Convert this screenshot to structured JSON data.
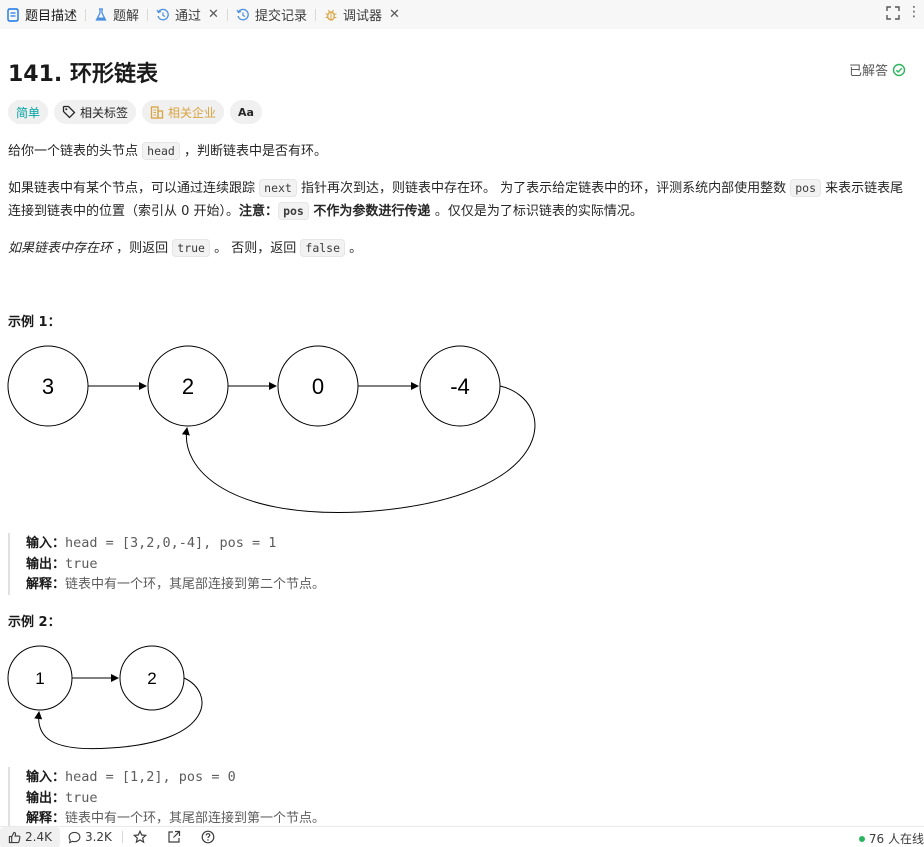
{
  "tabs": [
    {
      "label": "题目描述",
      "icon": "description-icon"
    },
    {
      "label": "题解",
      "icon": "flask-icon"
    },
    {
      "label": "通过",
      "icon": "history-icon"
    },
    {
      "label": "提交记录",
      "icon": "history-icon"
    },
    {
      "label": "调试器",
      "icon": "bug-icon"
    }
  ],
  "problem": {
    "title": "141. 环形链表",
    "solved_label": "已解答"
  },
  "tags": {
    "difficulty": "简单",
    "topics": "相关标签",
    "companies": "相关企业",
    "font_size": "Aa"
  },
  "description": {
    "p1_a": "给你一个链表的头节点 ",
    "p1_code": "head",
    "p1_b": " ，判断链表中是否有环。",
    "p2_a": "如果链表中有某个节点，可以通过连续跟踪 ",
    "p2_code1": "next",
    "p2_b": " 指针再次到达，则链表中存在环。 为了表示给定链表中的环，评测系统内部使用整数 ",
    "p2_code2": "pos",
    "p2_c": " 来表示链表尾连接到链表中的位置（索引从 0 开始）。",
    "p2_note": "注意：",
    "p2_code3": "pos",
    "p2_d": " 不作为参数进行传递 ",
    "p2_e": "。仅仅是为了标识链表的实际情况。",
    "p3_a": "如果链表中存在环",
    "p3_b": " ，则返回 ",
    "p3_code1": "true",
    "p3_c": " 。 否则，返回 ",
    "p3_code2": "false",
    "p3_d": " 。"
  },
  "example1": {
    "title": "示例 1：",
    "nodes": [
      "3",
      "2",
      "0",
      "-4"
    ],
    "input_label": "输入：",
    "input_value": "head = [3,2,0,-4], pos = 1",
    "output_label": "输出：",
    "output_value": "true",
    "explain_label": "解释：",
    "explain_value": "链表中有一个环，其尾部连接到第二个节点。"
  },
  "example2": {
    "title": "示例 2：",
    "nodes": [
      "1",
      "2"
    ],
    "input_label": "输入：",
    "input_value": "head = [1,2], pos = 0",
    "output_label": "输出：",
    "output_value": "true",
    "explain_label": "解释：",
    "explain_value": "链表中有一个环，其尾部连接到第一个节点。"
  },
  "bottom": {
    "likes": "2.4K",
    "comments": "3.2K",
    "online": "76 人在线"
  },
  "colors": {
    "easy": "#00a3a3",
    "company": "#d9a441",
    "accent_blue": "#1a73e8",
    "solved_green": "#2db55d"
  }
}
